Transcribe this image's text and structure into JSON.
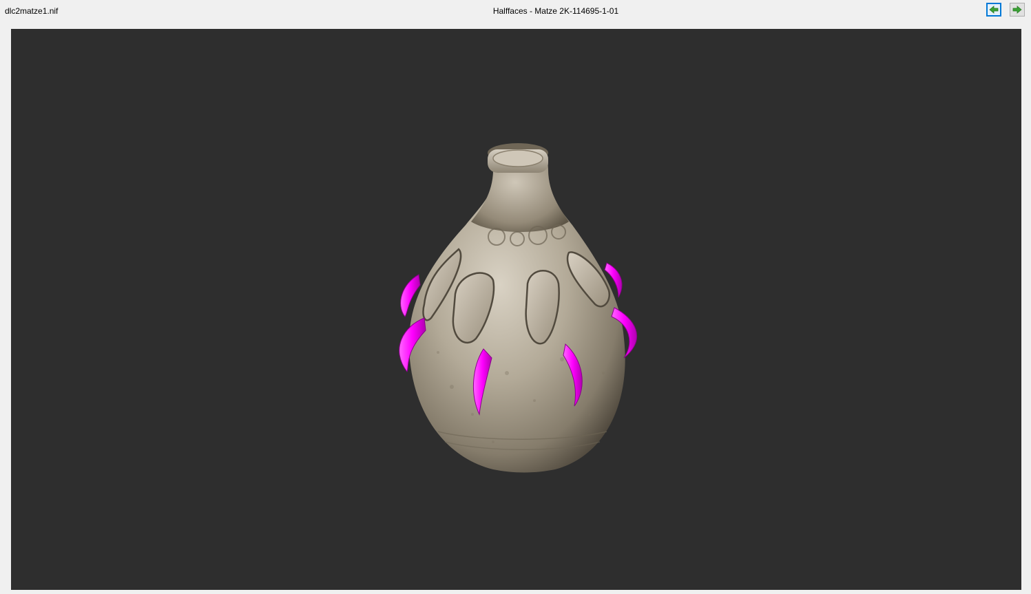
{
  "window": {
    "filename": "dlc2matze1.nif",
    "title": "Halffaces - Matze 2K-114695-1-01"
  },
  "toolbar": {
    "prev_icon": "arrow-left-icon",
    "next_icon": "arrow-right-icon"
  },
  "viewport": {
    "background_color": "#2e2e2e",
    "model": "jug",
    "highlight_color": "#ff00ff"
  }
}
